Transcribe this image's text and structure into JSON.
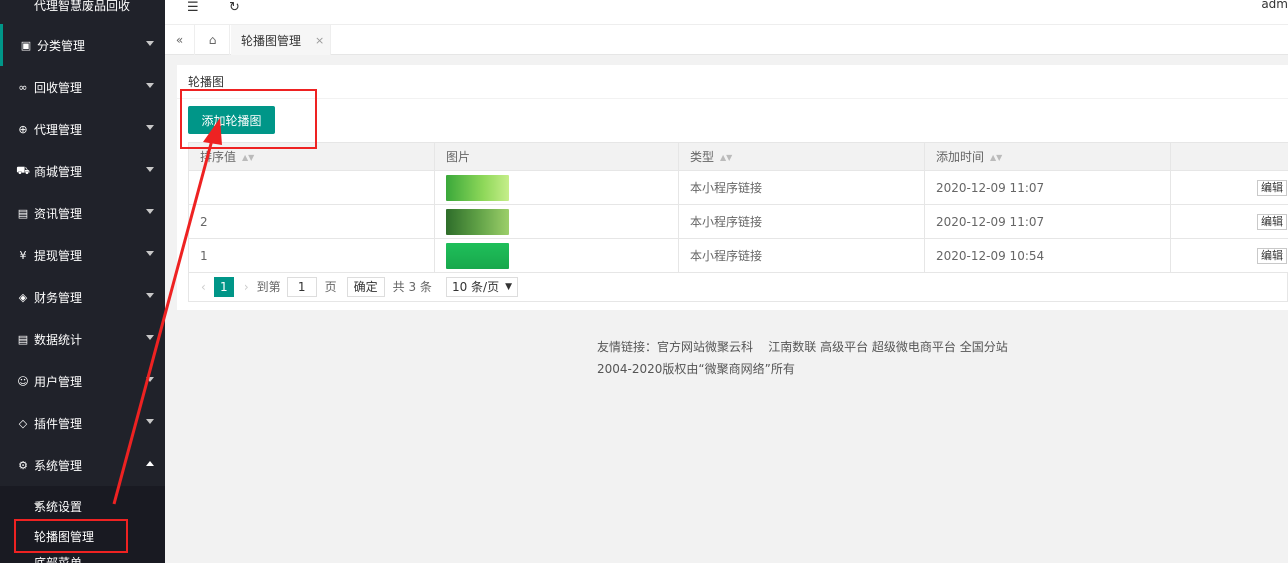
{
  "sidebar": {
    "top_title": "代理智慧废品回收",
    "items": [
      {
        "label": "分类管理",
        "icon": "grid-icon"
      },
      {
        "label": "回收管理",
        "icon": "link-icon"
      },
      {
        "label": "代理管理",
        "icon": "plus-circle-icon"
      },
      {
        "label": "商城管理",
        "icon": "cart-icon"
      },
      {
        "label": "资讯管理",
        "icon": "doc-icon"
      },
      {
        "label": "提现管理",
        "icon": "yen-icon"
      },
      {
        "label": "财务管理",
        "icon": "diamond-icon"
      },
      {
        "label": "数据统计",
        "icon": "chart-doc-icon"
      },
      {
        "label": "用户管理",
        "icon": "user-icon"
      },
      {
        "label": "插件管理",
        "icon": "box-icon"
      },
      {
        "label": "系统管理",
        "icon": "gear-icon"
      }
    ],
    "sub_items": [
      {
        "label": "系统设置"
      },
      {
        "label": "轮播图管理"
      },
      {
        "label": "底部菜单"
      }
    ]
  },
  "header": {
    "user": "adm"
  },
  "tabs": {
    "active_label": "轮播图管理",
    "close": "×"
  },
  "card": {
    "title": "轮播图",
    "add_button": "添加轮播图"
  },
  "table": {
    "headers": [
      "排序值",
      "图片",
      "类型",
      "添加时间",
      ""
    ],
    "rows": [
      {
        "sort": "",
        "type": "本小程序链接",
        "time": "2020-12-09 11:07",
        "action": "编辑"
      },
      {
        "sort": "2",
        "type": "本小程序链接",
        "time": "2020-12-09 11:07",
        "action": "编辑"
      },
      {
        "sort": "1",
        "type": "本小程序链接",
        "time": "2020-12-09 10:54",
        "action": "编辑"
      }
    ]
  },
  "pager": {
    "current": "1",
    "goto": "到第",
    "page_input": "1",
    "page_unit": "页",
    "confirm": "确定",
    "total": "共 3 条",
    "per_page": "10 条/页"
  },
  "footer": {
    "links_label": "友情链接：",
    "links": "官方网站微聚云科    江南数联 高级平台 超级微电商平台 全国分站",
    "copyright": "2004-2020版权由“微聚商网络”所有"
  },
  "colors": {
    "sidebar_bg": "#20222a",
    "accent": "#009688",
    "annotation": "#ee2222"
  }
}
